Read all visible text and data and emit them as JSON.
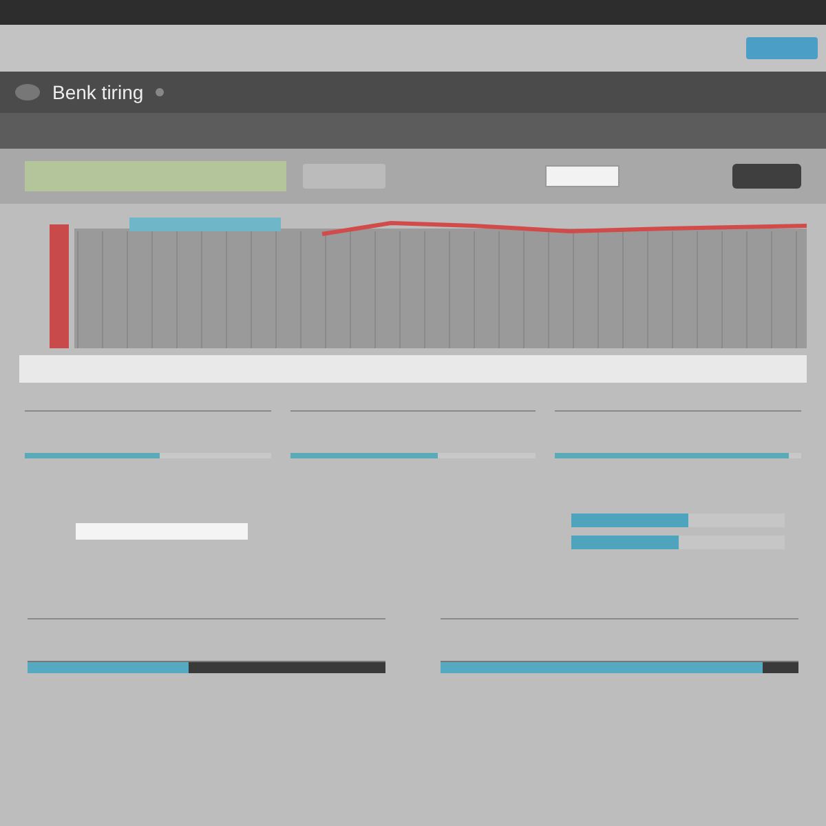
{
  "app_bar": {
    "title": "Benk tiring"
  },
  "meters": [
    {
      "level": 0.55
    },
    {
      "level": 0.6
    },
    {
      "level": 0.95
    }
  ],
  "summary_bars": [
    {
      "level": 0.55
    },
    {
      "level": 0.5
    }
  ],
  "compare_bars": [
    {
      "level": 0.45
    },
    {
      "level": 0.9
    }
  ]
}
